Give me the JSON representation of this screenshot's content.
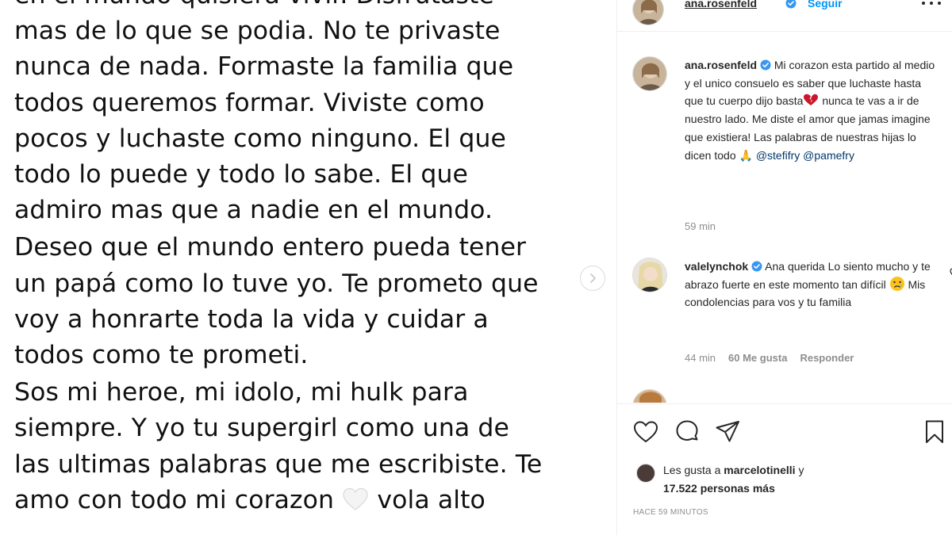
{
  "post_image": {
    "paragraphs": [
      [
        "en el mundo quisiera vivir. Disfrutaste",
        "mas de lo que se podia. No te privaste",
        "nunca de nada. Formaste la familia que",
        "todos queremos formar. Viviste como",
        "pocos y luchaste como ninguno. El que",
        "todo lo puede y todo lo sabe. El que",
        "admiro mas que a nadie en el mundo."
      ],
      [
        "Deseo que el mundo entero pueda tener",
        "un papá como lo tuve yo. Te prometo que",
        "voy a honrarte toda la vida y cuidar a",
        "todos como te prometi."
      ],
      [
        "Sos mi heroe, mi idolo, mi hulk para",
        "siempre. Y yo tu supergirl como una de",
        "las ultimas palabras que me escribiste. Te"
      ]
    ],
    "last_line_before": "amo con todo mi corazon",
    "last_line_after": "vola alto",
    "next_icon": "chevron-right-icon"
  },
  "header": {
    "username": "ana.rosenfeld",
    "follow_label": "Seguir",
    "more_icon": "more-horizontal-icon"
  },
  "caption": {
    "username": "ana.rosenfeld",
    "text_1": "Mi corazon esta partido al medio y el unico consuelo es saber que luchaste hasta que tu cuerpo dijo basta",
    "text_2": "nunca te vas a ir de nuestro lado. Me diste el amor que jamas imagine que existiera! Las palabras de nuestras hijas lo dicen todo",
    "emoji": "🙏",
    "mention_1": "@stefifry",
    "mention_2": "@pamefry",
    "time": "59 min"
  },
  "comments": [
    {
      "username": "valelynchok",
      "text": "Ana querida Lo siento mucho y te abrazo fuerte en este momento tan difícil",
      "text_after": "Mis condolencias para vos y tu familia",
      "time": "44 min",
      "likes": "60 Me gusta",
      "reply": "Responder"
    }
  ],
  "actions": {
    "like_icon": "heart-icon",
    "comment_icon": "comment-icon",
    "share_icon": "send-icon",
    "save_icon": "bookmark-icon"
  },
  "likes": {
    "prefix": "Les gusta a",
    "user": "marcelotinelli",
    "connector": "y",
    "count_text": "17.522 personas más"
  },
  "timestamp": "HACE 59 MINUTOS",
  "colors": {
    "link_blue": "#0095f6",
    "verified_blue": "#3897f0",
    "mention": "#00376b",
    "muted": "#8e8e8e",
    "heart_red": "#c9182b"
  }
}
